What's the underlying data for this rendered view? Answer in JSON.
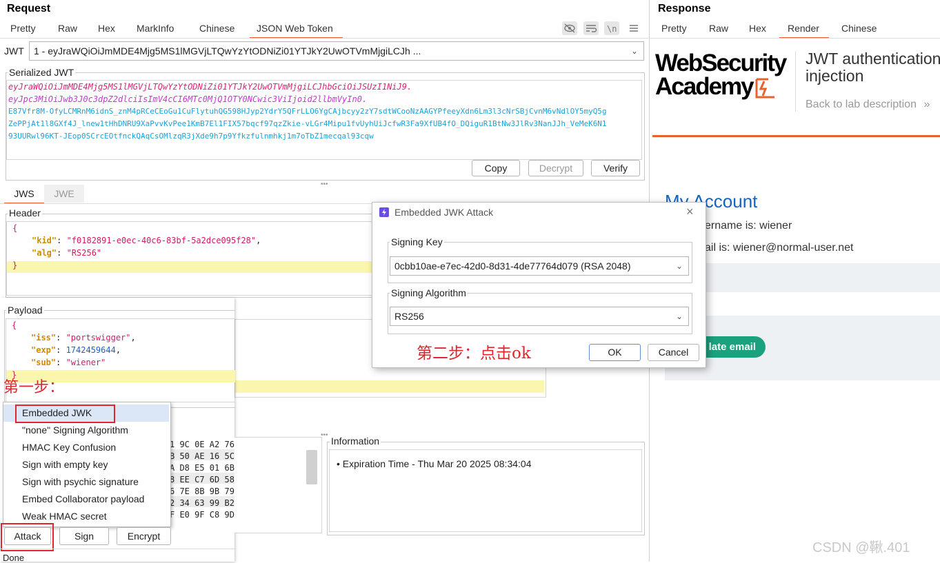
{
  "request": {
    "title": "Request",
    "tabs": [
      "Pretty",
      "Raw",
      "Hex",
      "MarkInfo",
      "Chinese",
      "JSON Web Token"
    ],
    "active_tab": "JSON Web Token",
    "jwt_label": "JWT",
    "jwt_selected": "1 - eyJraWQiOiJmMDE4Mjg5MS1lMGVjLTQwYzYtODNiZi01YTJkY2UwOTVmMjgiLCJh ...",
    "serialized_title": "Serialized JWT",
    "serialized_lines": [
      "eyJraWQiOiJmMDE4Mjg5MS1lMGVjLTQwYzYtODNiZi01YTJkY2UwOTVmMjgiLCJhbGciOiJSUzI1NiJ9.",
      "eyJpc3MiOiJwb3J0c3dpZ2dlciIsImV4cCI6MTc0MjQ1OTY0NCwic3ViIjoid2llbmVyIn0.",
      "E87Vfr8M-OfyLCMRnM6idnS_znM4pRCeCEoGu1CuFlytuhQG598HJyp2YdrY5QFrLLO6YgCAjbcyy2zY7sdtWCooNzAAGYPfeeyXdn6Lm3l3cNrSBjCvnM6vNdlOY5myQ5g",
      "ZePPjAt1l8GXf4J_lnew1tHhDNRU9XaPvvKvPee1KmB7El1FIX57bqcf97qzZkie-vLGr4Mipu1fvUyhUiJcfwR3Fa9XfUB4fO_DQiguR1BtNw3JlRv3NanJJh_VeMeK6N1",
      "93UURwl96KT-JEop0SCrcEOtfnckQAqCsOMlzqR3jXde9h7p9Yfkzfulnmhkj1m7oTbZ1mecqal93cqw"
    ],
    "buttons": {
      "copy": "Copy",
      "decrypt": "Decrypt",
      "verify": "Verify"
    },
    "sub_tabs": [
      "JWS",
      "JWE"
    ],
    "header_title": "Header",
    "header_lines": {
      "open": "{",
      "kid_key": "\"kid\"",
      "kid_val": "\"f0182891-e0ec-40c6-83bf-5a2dce095f28\"",
      "alg_key": "\"alg\"",
      "alg_val": "\"RS256\"",
      "close": "}"
    },
    "payload_title": "Payload",
    "payload_lines": {
      "open": "{",
      "iss_key": "\"iss\"",
      "iss_val": "\"portswigger\"",
      "exp_key": "\"exp\"",
      "exp_val": "1742459644",
      "sub_key": "\"sub\"",
      "sub_val": "\"wiener\"",
      "close": "}"
    },
    "attack_menu": [
      "Embedded JWK",
      "\"none\" Signing Algorithm",
      "HMAC Key Confusion",
      "Sign with empty key",
      "Sign with psychic signature",
      "Embed Collaborator payload",
      "Weak HMAC secret"
    ],
    "bottom_buttons": {
      "attack": "Attack",
      "sign": "Sign",
      "encrypt": "Encrypt"
    },
    "hex_rows": [
      "1 9C 0E A2 76",
      "B 50 AE 16 5C",
      "A D8 E5 01 6B",
      "8 EE C7 6D 58",
      "6 7E 8B 9B 79",
      "2 34 63 99 B2",
      "F E0 9F C8 9D"
    ],
    "information_title": "Information",
    "information_item": "Expiration Time - Thu Mar 20 2025 08:34:04",
    "status": "Done"
  },
  "response": {
    "title": "Response",
    "tabs": [
      "Pretty",
      "Raw",
      "Hex",
      "Render",
      "Chinese"
    ],
    "active_tab": "Render",
    "logo_line1": "WebSecurity",
    "logo_line2": "Academy",
    "lab_title_line1": "JWT authentication",
    "lab_title_line2": "injection",
    "back_link": "Back to lab description",
    "account_heading": "My Account",
    "username_text": "ername is: wiener",
    "email_text": "ail is: wiener@normal-user.net",
    "update_btn": "late email"
  },
  "dialog": {
    "title": "Embedded JWK Attack",
    "signing_key_label": "Signing Key",
    "signing_key_value": "0cbb10ae-e7ec-42d0-8d31-4de77764d079 (RSA 2048)",
    "signing_alg_label": "Signing Algorithm",
    "signing_alg_value": "RS256",
    "ok": "OK",
    "cancel": "Cancel"
  },
  "annotations": {
    "step1": "第一步：",
    "step2": "第二步：点击ok"
  },
  "watermark": "CSDN @鞦.401",
  "colors": {
    "accent": "#e8622c",
    "jwt_header": "#e0237a",
    "jwt_payload": "#c23ad1",
    "jwt_signature": "#1aa3d6",
    "json_key": "#cf8a00",
    "json_string": "#d11a68",
    "json_number": "#1e5fd1",
    "highlight": "#fbf6ad",
    "annotation_red": "#e0262c",
    "teal_button": "#1aa27f",
    "link_blue": "#1565c0"
  }
}
